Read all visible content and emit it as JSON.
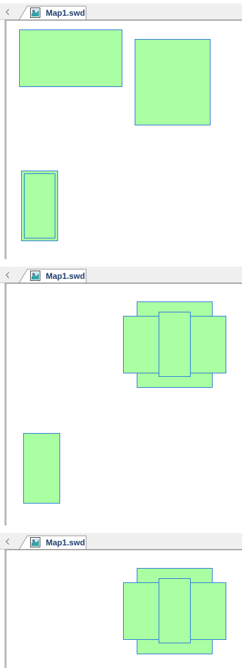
{
  "frames": [
    {
      "tab": {
        "label": "Map1.swd",
        "icon": "map-document-icon"
      },
      "scroll_icon": "scroll-left-icon",
      "shape_color": "#aaffa2",
      "shape_border": "#2f7fd6"
    },
    {
      "tab": {
        "label": "Map1.swd",
        "icon": "map-document-icon"
      },
      "scroll_icon": "scroll-left-icon",
      "shape_color": "#aaffa2",
      "shape_border": "#2f7fd6"
    },
    {
      "tab": {
        "label": "Map1.swd",
        "icon": "map-document-icon"
      },
      "scroll_icon": "scroll-left-icon",
      "shape_color": "#aaffa2",
      "shape_border": "#2f7fd6"
    }
  ]
}
